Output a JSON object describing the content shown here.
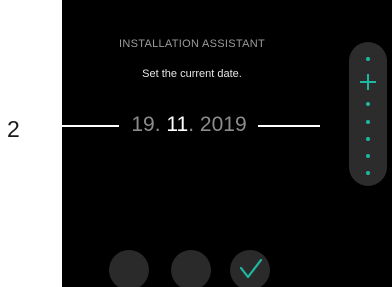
{
  "step_number": "2",
  "screen": {
    "title": "INSTALLATION ASSISTANT",
    "subtitle": "Set the current date.",
    "date": {
      "day": "19",
      "month": "11",
      "year": "2019",
      "separator": ".",
      "active_field": "month"
    },
    "scroll": {
      "up_icon": "plus-icon",
      "indicator_icon": "dot-icon"
    },
    "softkeys": {
      "left_icon": "",
      "middle_icon": "",
      "right_icon": "check-icon"
    }
  },
  "colors": {
    "accent": "#1fb7a0",
    "screen_background": "#000000",
    "panel": "#2c2c2c",
    "inactive_text": "#8c8c8c"
  }
}
